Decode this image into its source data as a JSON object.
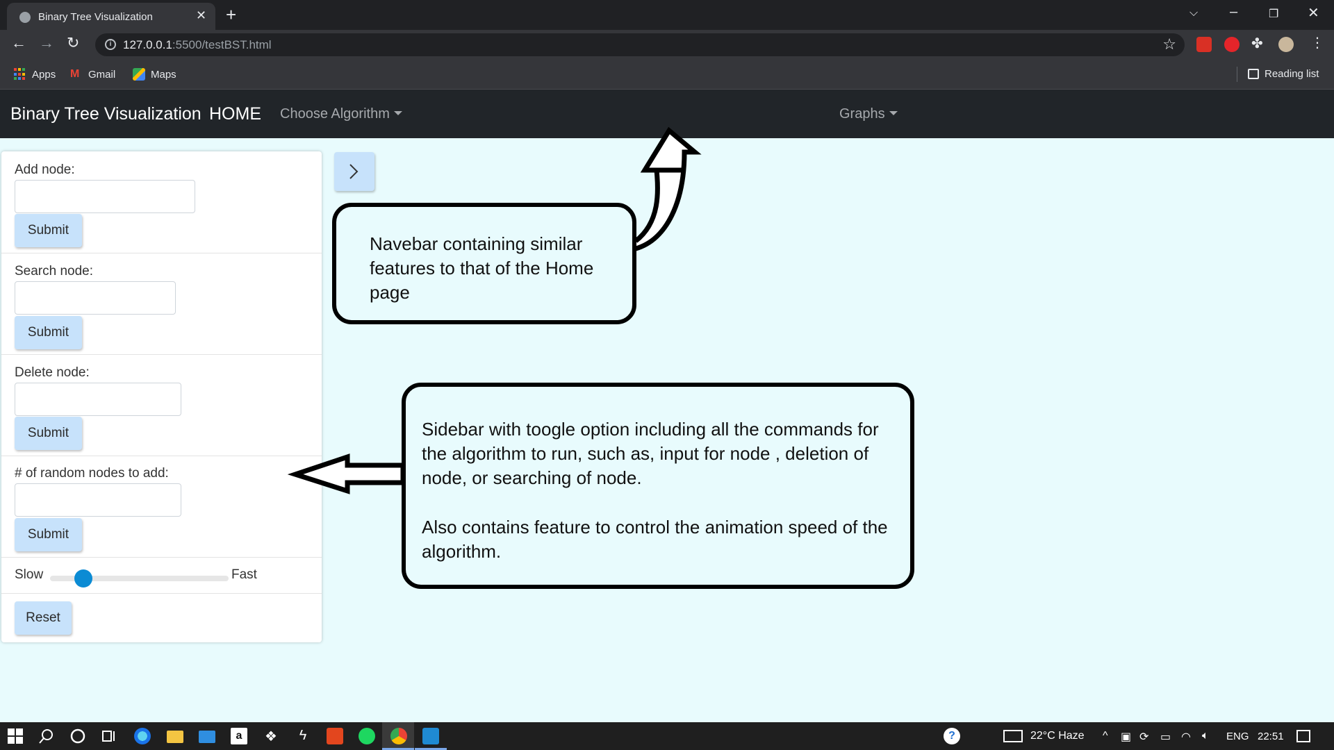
{
  "browser": {
    "tab_title": "Binary Tree Visualization",
    "url_host": "127.0.0.1",
    "url_rest": ":5500/testBST.html",
    "bookmarks": [
      "Apps",
      "Gmail",
      "Maps"
    ],
    "reading_list": "Reading list"
  },
  "navbar": {
    "brand": "Binary Tree Visualization",
    "home": "HOME",
    "choose_algorithm": "Choose Algorithm",
    "graphs": "Graphs"
  },
  "sidebar": {
    "add_label": "Add node:",
    "search_label": "Search node:",
    "delete_label": "Delete node:",
    "random_label": "# of random nodes to add:",
    "submit": "Submit",
    "slow": "Slow",
    "fast": "Fast",
    "reset": "Reset",
    "speed_fraction": 0.15
  },
  "annotations": {
    "navbar_note": "Navebar containing similar features to that of the Home page",
    "sidebar_note_1": "Sidebar with toogle option including all the commands for the algorithm to run, such as, input for node , deletion of node, or searching of node.",
    "sidebar_note_2": "Also contains feature to control the animation speed of the algorithm."
  },
  "taskbar": {
    "weather": "22°C  Haze",
    "language": "ENG",
    "time": "22:51"
  },
  "colors": {
    "page_bg": "#e8fbfd",
    "navbar_bg": "#212529",
    "button_bg": "#c7e2fb",
    "slider_thumb": "#0b8bd4"
  }
}
